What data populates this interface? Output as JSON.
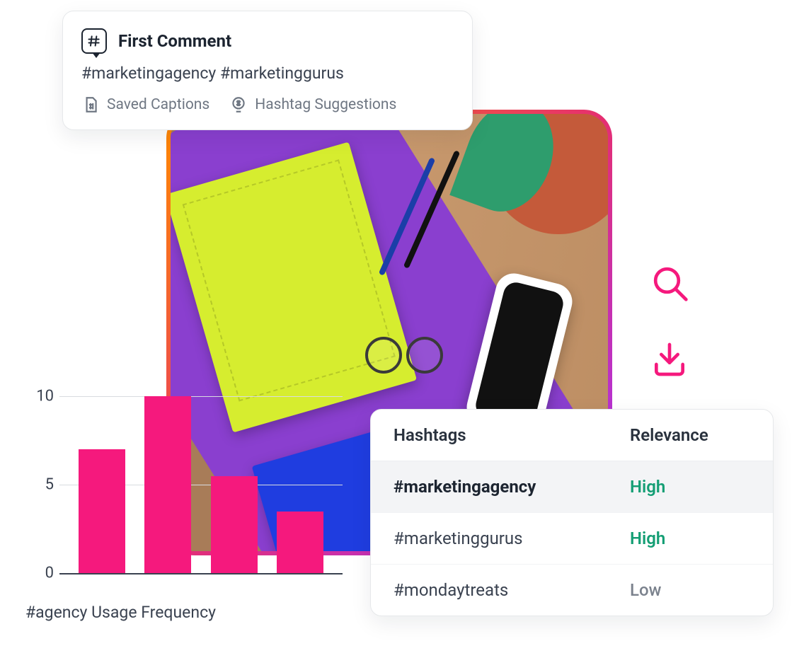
{
  "first_comment": {
    "title": "First Comment",
    "text": "#marketingagency #marketinggurus",
    "saved_captions_label": "Saved Captions",
    "hashtag_suggestions_label": "Hashtag Suggestions"
  },
  "side_icons": {
    "search": "search-icon",
    "download": "download-icon"
  },
  "hashtag_table": {
    "header_hashtags": "Hashtags",
    "header_relevance": "Relevance",
    "rows": [
      {
        "tag": "#marketingagency",
        "relevance": "High",
        "level": "high",
        "selected": true
      },
      {
        "tag": "#marketinggurus",
        "relevance": "High",
        "level": "high",
        "selected": false
      },
      {
        "tag": "#mondaytreats",
        "relevance": "Low",
        "level": "low",
        "selected": false
      }
    ]
  },
  "chart_data": {
    "type": "bar",
    "label": "#agency Usage Frequency",
    "ylim": [
      0,
      10
    ],
    "yticks": [
      0,
      5,
      10
    ],
    "categories": [
      "",
      "",
      "",
      ""
    ],
    "values": [
      7,
      10,
      5.5,
      3.5
    ]
  },
  "colors": {
    "accent_pink": "#f5197d",
    "rel_high": "#149e74",
    "rel_low": "#7b828d"
  }
}
